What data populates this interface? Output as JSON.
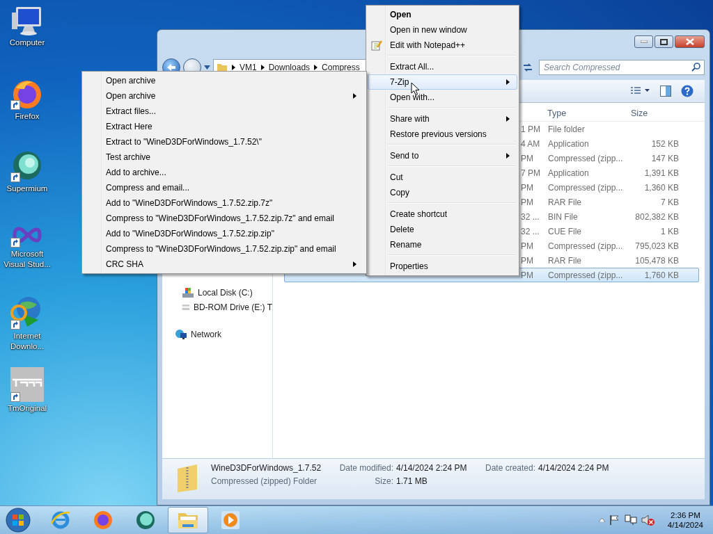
{
  "desktop_icons": [
    {
      "label": "Computer",
      "kind": "computer",
      "shortcut": false
    },
    {
      "label": "Firefox",
      "kind": "firefox",
      "shortcut": true
    },
    {
      "label": "Supermium",
      "kind": "supermium",
      "shortcut": true
    },
    {
      "label": "Microsoft Visual Stud...",
      "kind": "vs",
      "shortcut": true
    },
    {
      "label": "Internet Downlo...",
      "kind": "idm",
      "shortcut": true
    },
    {
      "label": "TmOriginal",
      "kind": "tm",
      "shortcut": true
    }
  ],
  "explorer": {
    "breadcrumb": [
      "VM1",
      "Downloads",
      "Compress"
    ],
    "search": {
      "placeholder": "Search Compressed"
    },
    "columns": [
      {
        "label": "Type"
      },
      {
        "label": "Size"
      }
    ],
    "rows": [
      {
        "date": "1 PM",
        "type": "File folder",
        "selected": false
      },
      {
        "date": "4 AM",
        "type": "Application",
        "size": "152 KB",
        "selected": false
      },
      {
        "date": "PM",
        "type": "Compressed (zipp...",
        "size": "147 KB",
        "selected": false
      },
      {
        "date": "7 PM",
        "type": "Application",
        "size": "1,391 KB",
        "selected": false
      },
      {
        "date": "PM",
        "type": "Compressed (zipp...",
        "size": "1,360 KB",
        "selected": false
      },
      {
        "date": "PM",
        "type": "RAR File",
        "size": "7 KB",
        "selected": false
      },
      {
        "date": "32 ...",
        "type": "BIN File",
        "size": "802,382 KB",
        "selected": false
      },
      {
        "date": "32 ...",
        "type": "CUE File",
        "size": "1 KB",
        "selected": false
      },
      {
        "date": "PM",
        "type": "Compressed (zipp...",
        "size": "795,023 KB",
        "selected": false
      },
      {
        "date": "PM",
        "type": "RAR File",
        "size": "105,478 KB",
        "selected": false
      },
      {
        "date": "PM",
        "type": "Compressed (zipp...",
        "size": "1,760 KB",
        "selected": true
      }
    ],
    "nav_items": [
      {
        "label": "Local Disk (C:)",
        "kind": "disk"
      },
      {
        "label": "BD-ROM Drive (E:) T",
        "kind": "optical"
      },
      {
        "label": "Network",
        "kind": "network"
      }
    ],
    "details": {
      "name": "WineD3DForWindows_1.7.52",
      "type": "Compressed (zipped) Folder",
      "columns": [
        [
          {
            "label": "Date modified:",
            "value": "4/14/2024 2:24 PM"
          },
          {
            "label": "Size:",
            "value": "1.71 MB"
          }
        ],
        [
          {
            "label": "Date created:",
            "value": "4/14/2024 2:24 PM"
          }
        ]
      ]
    }
  },
  "context_menu": {
    "groups": [
      {
        "items": [
          {
            "label": "Open",
            "bold": true,
            "has_icon": false,
            "submenu": false,
            "selected": false
          },
          {
            "label": "Open in new window",
            "bold": false,
            "has_icon": false,
            "submenu": false,
            "selected": false
          },
          {
            "label": "Edit with Notepad++",
            "bold": false,
            "has_icon": true,
            "submenu": false,
            "selected": false
          }
        ]
      },
      {
        "items": [
          {
            "label": "Extract All...",
            "bold": false,
            "has_icon": false,
            "submenu": false,
            "selected": false
          },
          {
            "label": "7-Zip",
            "bold": false,
            "has_icon": false,
            "submenu": true,
            "selected": true
          },
          {
            "label": "Open with...",
            "bold": false,
            "has_icon": false,
            "submenu": false,
            "selected": false
          }
        ]
      },
      {
        "items": [
          {
            "label": "Share with",
            "bold": false,
            "has_icon": false,
            "submenu": true,
            "selected": false
          },
          {
            "label": "Restore previous versions",
            "bold": false,
            "has_icon": false,
            "submenu": false,
            "selected": false
          }
        ]
      },
      {
        "items": [
          {
            "label": "Send to",
            "bold": false,
            "has_icon": false,
            "submenu": true,
            "selected": false
          }
        ]
      },
      {
        "items": [
          {
            "label": "Cut",
            "bold": false,
            "has_icon": false,
            "submenu": false,
            "selected": false
          },
          {
            "label": "Copy",
            "bold": false,
            "has_icon": false,
            "submenu": false,
            "selected": false
          }
        ]
      },
      {
        "items": [
          {
            "label": "Create shortcut",
            "bold": false,
            "has_icon": false,
            "submenu": false,
            "selected": false
          },
          {
            "label": "Delete",
            "bold": false,
            "has_icon": false,
            "submenu": false,
            "selected": false
          },
          {
            "label": "Rename",
            "bold": false,
            "has_icon": false,
            "submenu": false,
            "selected": false
          }
        ]
      },
      {
        "items": [
          {
            "label": "Properties",
            "bold": false,
            "has_icon": false,
            "submenu": false,
            "selected": false
          }
        ]
      }
    ]
  },
  "submenu": {
    "items": [
      {
        "label": "Open archive",
        "submenu": false
      },
      {
        "label": "Open archive",
        "submenu": true
      },
      {
        "label": "Extract files...",
        "submenu": false
      },
      {
        "label": "Extract Here",
        "submenu": false
      },
      {
        "label": "Extract to \"WineD3DForWindows_1.7.52\\\"",
        "submenu": false
      },
      {
        "label": "Test archive",
        "submenu": false
      },
      {
        "label": "Add to archive...",
        "submenu": false
      },
      {
        "label": "Compress and email...",
        "submenu": false
      },
      {
        "label": "Add to \"WineD3DForWindows_1.7.52.zip.7z\"",
        "submenu": false
      },
      {
        "label": "Compress to \"WineD3DForWindows_1.7.52.zip.7z\" and email",
        "submenu": false
      },
      {
        "label": "Add to \"WineD3DForWindows_1.7.52.zip.zip\"",
        "submenu": false
      },
      {
        "label": "Compress to \"WineD3DForWindows_1.7.52.zip.zip\" and email",
        "submenu": false
      },
      {
        "label": "CRC SHA",
        "submenu": true
      }
    ]
  },
  "taskbar": {
    "apps": [
      {
        "kind": "ie",
        "active": false
      },
      {
        "kind": "firefox",
        "active": false
      },
      {
        "kind": "supermium",
        "active": false
      },
      {
        "kind": "explorer",
        "active": true
      },
      {
        "kind": "media",
        "active": false
      }
    ],
    "clock": {
      "time": "2:36 PM",
      "date": "4/14/2024"
    }
  }
}
